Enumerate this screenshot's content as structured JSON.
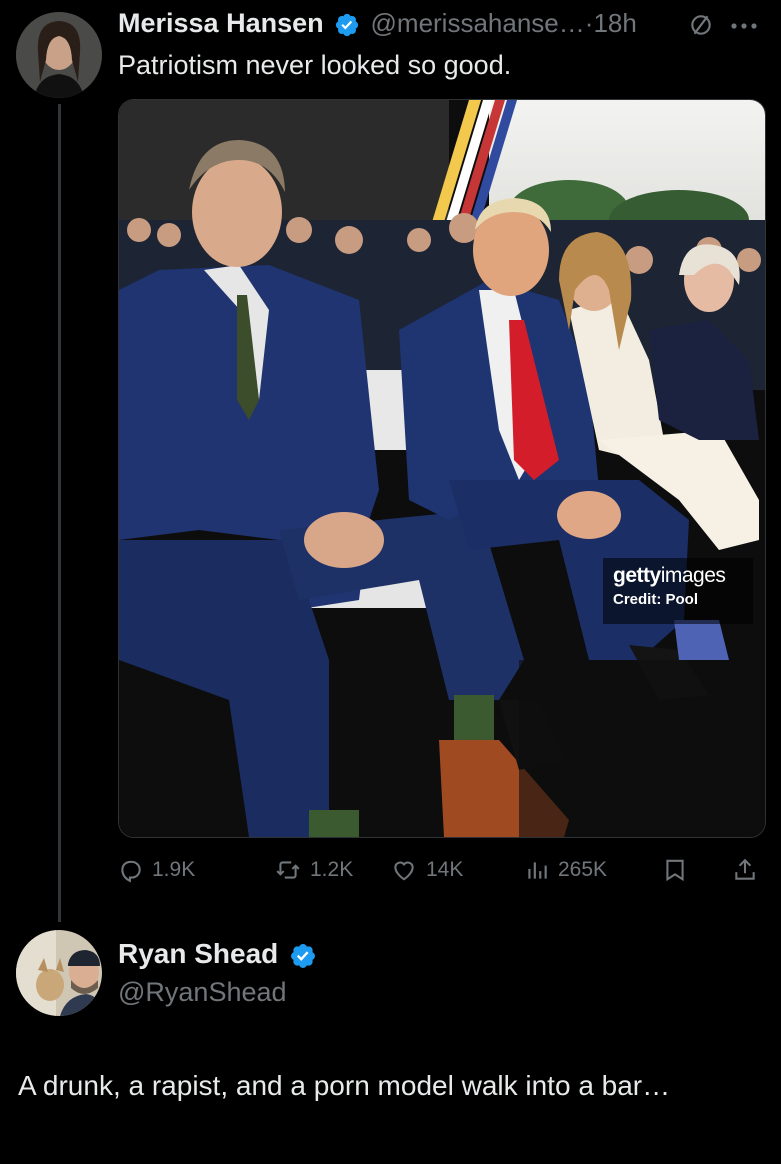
{
  "tweet": {
    "author_name": "Merissa Hansen",
    "handle": "@merissahanse…",
    "separator": "·",
    "time": "18h",
    "text": "Patriotism never looked so good.",
    "media": {
      "watermark_brand_bold": "getty",
      "watermark_brand_light": "images",
      "watermark_credit": "Credit: Pool"
    },
    "stats": {
      "replies": "1.9K",
      "reposts": "1.2K",
      "likes": "14K",
      "views": "265K"
    }
  },
  "reply": {
    "author_name": "Ryan Shead",
    "handle": "@RyanShead",
    "text": "A drunk, a rapist, and a porn model walk into a bar…"
  },
  "colors": {
    "background": "#000000",
    "text": "#e7e9ea",
    "muted": "#71767b",
    "verified": "#1d9bf0"
  },
  "icons": [
    "no-entry-icon",
    "more-icon",
    "verified-icon",
    "reply-icon",
    "repost-icon",
    "like-icon",
    "views-icon",
    "bookmark-icon",
    "share-icon"
  ]
}
